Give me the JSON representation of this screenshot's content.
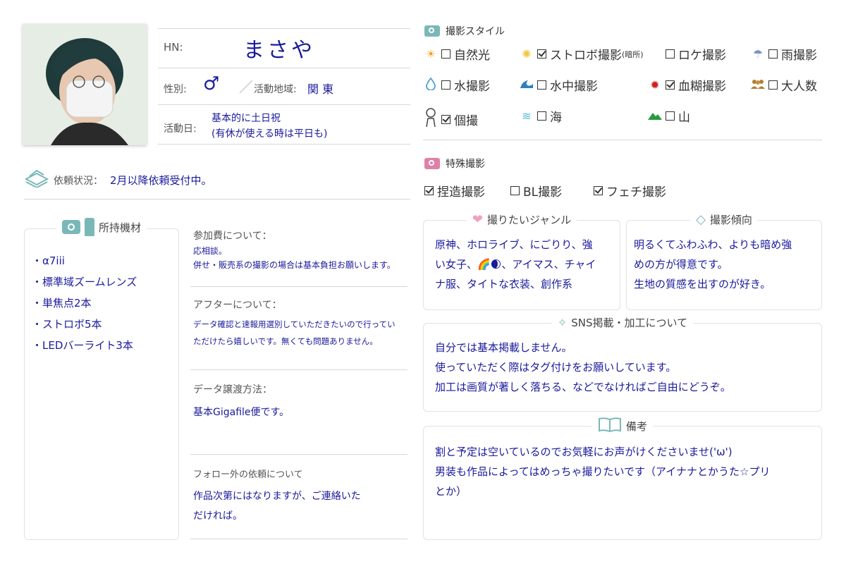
{
  "profile": {
    "hn_label": "HN:",
    "hn_value": "まさや",
    "gender_label": "性別:",
    "gender_value": "♂",
    "area_label": "活動地域:",
    "area_value": "関 東",
    "days_label": "活動日:",
    "days_line1": "基本的に土日祝",
    "days_line2": "(有休が使える時は平日も)"
  },
  "request": {
    "label": "依頼状況：",
    "value": "2月以降依頼受付中。"
  },
  "equipment": {
    "title": "所持機材",
    "items": [
      "・α7iii",
      "・標準域ズームレンズ",
      "・単焦点2本",
      "・ストロボ5本",
      "・LEDバーライト3本"
    ]
  },
  "fee": {
    "title": "参加費について：",
    "line1": "応相談。",
    "line2": "併せ・販売系の撮影の場合は基本負担お願いします。"
  },
  "after": {
    "title": "アフターについて：",
    "line1": "データ確認と速報用選別していただきたいので行ってい",
    "line2": "ただけたら嬉しいです。無くても問題ありません。"
  },
  "data_transfer": {
    "title": "データ譲渡方法：",
    "value": "基本Gigafile便です。"
  },
  "non_follower": {
    "title": "フォロー外の依頼について",
    "line1": "作品次第にはなりますが、ご連絡いた",
    "line2": "だければ。"
  },
  "style": {
    "title": "撮影スタイル",
    "options": [
      {
        "label": "自然光",
        "checked": false,
        "icon": "sun-icon",
        "glyph": "☀",
        "color": "#f0a020"
      },
      {
        "label": "ストロボ撮影",
        "note": "(暗所)",
        "checked": true,
        "icon": "strobe-icon",
        "glyph": "✺",
        "color": "#f0c840"
      },
      {
        "label": "ロケ撮影",
        "checked": false,
        "icon": "",
        "glyph": "",
        "color": ""
      },
      {
        "label": "雨撮影",
        "checked": false,
        "icon": "umbrella-icon",
        "glyph": "☂",
        "color": "#7a90c8"
      },
      {
        "label": "水撮影",
        "checked": false,
        "icon": "water-drop-icon",
        "glyph": "💧",
        "color": "#4aa0d8"
      },
      {
        "label": "水中撮影",
        "checked": false,
        "icon": "wave-icon",
        "glyph": "◣",
        "color": "#2a80c0"
      },
      {
        "label": "血糊撮影",
        "checked": true,
        "icon": "blood-icon",
        "glyph": "✹",
        "color": "#d02020"
      },
      {
        "label": "大人数",
        "checked": false,
        "icon": "group-icon",
        "glyph": "👥",
        "color": "#b08030"
      },
      {
        "label": "個撮",
        "checked": true,
        "icon": "person-icon",
        "glyph": "☻",
        "color": "#555"
      },
      {
        "label": "海",
        "checked": false,
        "icon": "sea-icon",
        "glyph": "≋",
        "color": "#50b8e0"
      },
      {
        "label": "山",
        "checked": false,
        "icon": "mountain-icon",
        "glyph": "▲",
        "color": "#2a9a40"
      }
    ]
  },
  "special": {
    "title": "特殊撮影",
    "options": [
      {
        "label": "捏造撮影",
        "checked": true
      },
      {
        "label": "BL撮影",
        "checked": false
      },
      {
        "label": "フェチ撮影",
        "checked": true
      }
    ]
  },
  "genre": {
    "title": "撮りたいジャンル",
    "line1": "原神、ホロライブ、にごりり、強",
    "line2": "い女子、🌈🌒、アイマス、チャイ",
    "line3": "ナ服、タイトな衣装、創作系"
  },
  "tendency": {
    "title": "撮影傾向",
    "line1": "明るくてふわふわ、よりも暗め強",
    "line2": "めの方が得意です。",
    "line3": "生地の質感を出すのが好き。"
  },
  "sns": {
    "title": "SNS掲載・加工について",
    "line1": "自分では基本掲載しません。",
    "line2": "使っていただく際はタグ付けをお願いしています。",
    "line3": "加工は画質が著しく落ちる、などでなければご自由にどうぞ。"
  },
  "notes": {
    "title": "備考",
    "line1": "割と予定は空いているのでお気軽にお声がけくださいませ('ω')",
    "line2": "男装も作品によってはめっちゃ撮りたいです（アイナナとかうた☆プリ",
    "line3": "とか）"
  },
  "colors": {
    "navy": "#1a1a9c",
    "teal": "#7ab8b8",
    "pink": "#e080a8"
  }
}
